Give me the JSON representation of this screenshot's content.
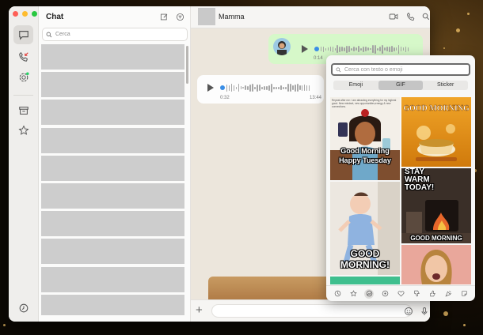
{
  "window": {
    "traffic_lights": [
      "#fe5f57",
      "#febc2e",
      "#28c840"
    ]
  },
  "rail": {
    "items": [
      {
        "name": "chats",
        "icon": "chat-bubble-icon",
        "active": true
      },
      {
        "name": "calls",
        "icon": "phone-icon",
        "badge_color": "#e0322e"
      },
      {
        "name": "status",
        "icon": "status-ring-icon",
        "badge_color": "#25d366"
      },
      {
        "name": "archived",
        "icon": "archive-box-icon"
      },
      {
        "name": "starred",
        "icon": "star-icon"
      },
      {
        "name": "settings",
        "icon": "gear-icon"
      }
    ]
  },
  "chat_list": {
    "title": "Chat",
    "new_chat_icon": "compose-icon",
    "filter_icon": "filter-icon",
    "search_placeholder": "Cerca",
    "row_count": 10
  },
  "conversation": {
    "contact_name": "Mamma",
    "header_icons": [
      "video-call-icon",
      "phone-icon",
      "search-icon"
    ],
    "messages": [
      {
        "direction": "outgoing",
        "type": "voice",
        "time": "0:14"
      },
      {
        "direction": "incoming",
        "type": "voice",
        "duration": "0:32",
        "time": "13:44"
      }
    ],
    "composer": {
      "attach_icon": "plus-icon",
      "emoji_icon": "smiley-icon",
      "mic_icon": "microphone-icon"
    }
  },
  "gif_picker": {
    "search_placeholder": "Cerca con testo o emoji",
    "tabs": [
      "Emoji",
      "GIF",
      "Sticker"
    ],
    "active_tab": "GIF",
    "gifs": [
      {
        "caption": "Good Morning\nHappy Tuesday",
        "header_text": "Repeat after me: I am attracting everything for my highest good. New mindset, new opportunities,energy & new connections."
      },
      {
        "caption": ""
      },
      {
        "caption": "STAY\nWARM\nTODAY!"
      },
      {
        "caption": "GOOD\nMORNING!"
      },
      {
        "caption": "GOOD MORNING"
      },
      {
        "caption": ""
      },
      {
        "caption": ""
      }
    ],
    "bottom_icons": [
      "recent-icon",
      "favorites-star-icon",
      "trending-icon",
      "category-icon",
      "heart-icon",
      "thumb-down-icon",
      "thumb-up-icon",
      "party-icon",
      "sticker-icon"
    ],
    "active_bottom_icon": "trending-icon"
  }
}
